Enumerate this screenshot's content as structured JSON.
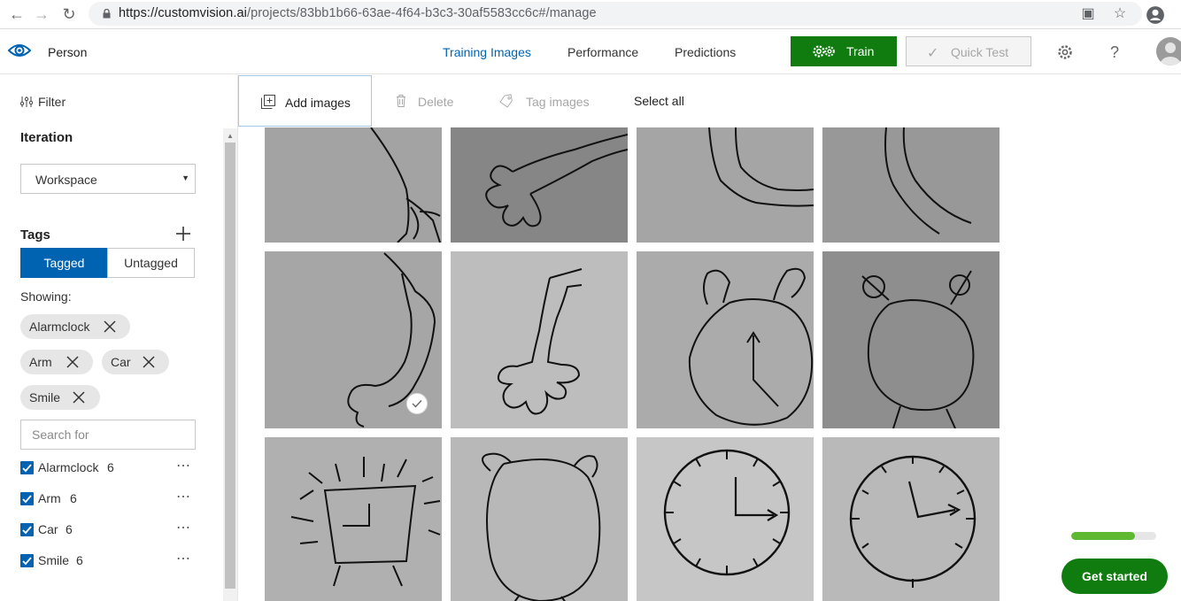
{
  "browser": {
    "url_host": "https://customvision.ai",
    "url_path": "/projects/83bb1b66-63ae-4f64-b3c3-30af5583cc6c#/manage"
  },
  "header": {
    "project_name": "Person",
    "tabs": [
      {
        "label": "Training Images",
        "active": true
      },
      {
        "label": "Performance",
        "active": false
      },
      {
        "label": "Predictions",
        "active": false
      }
    ],
    "train_label": "Train",
    "quick_test_label": "Quick Test"
  },
  "sidebar": {
    "filter_label": "Filter",
    "iteration_title": "Iteration",
    "iteration_value": "Workspace",
    "tags_title": "Tags",
    "tagged_label": "Tagged",
    "untagged_label": "Untagged",
    "showing_label": "Showing:",
    "active_filters": [
      "Alarmclock",
      "Arm",
      "Car",
      "Smile"
    ],
    "search_placeholder": "Search for",
    "tags": [
      {
        "name": "Alarmclock",
        "count": "6",
        "checked": true
      },
      {
        "name": "Arm",
        "count": "6",
        "checked": true
      },
      {
        "name": "Car",
        "count": "6",
        "checked": true
      },
      {
        "name": "Smile",
        "count": "6",
        "checked": true
      }
    ]
  },
  "toolbar": {
    "add_images": "Add images",
    "delete": "Delete",
    "tag_images": "Tag images",
    "select_all": "Select all"
  },
  "onboarding": {
    "progress": 0.75,
    "get_started": "Get started"
  },
  "colors": {
    "accent_blue": "#0063b1",
    "train_green": "#107c10"
  }
}
